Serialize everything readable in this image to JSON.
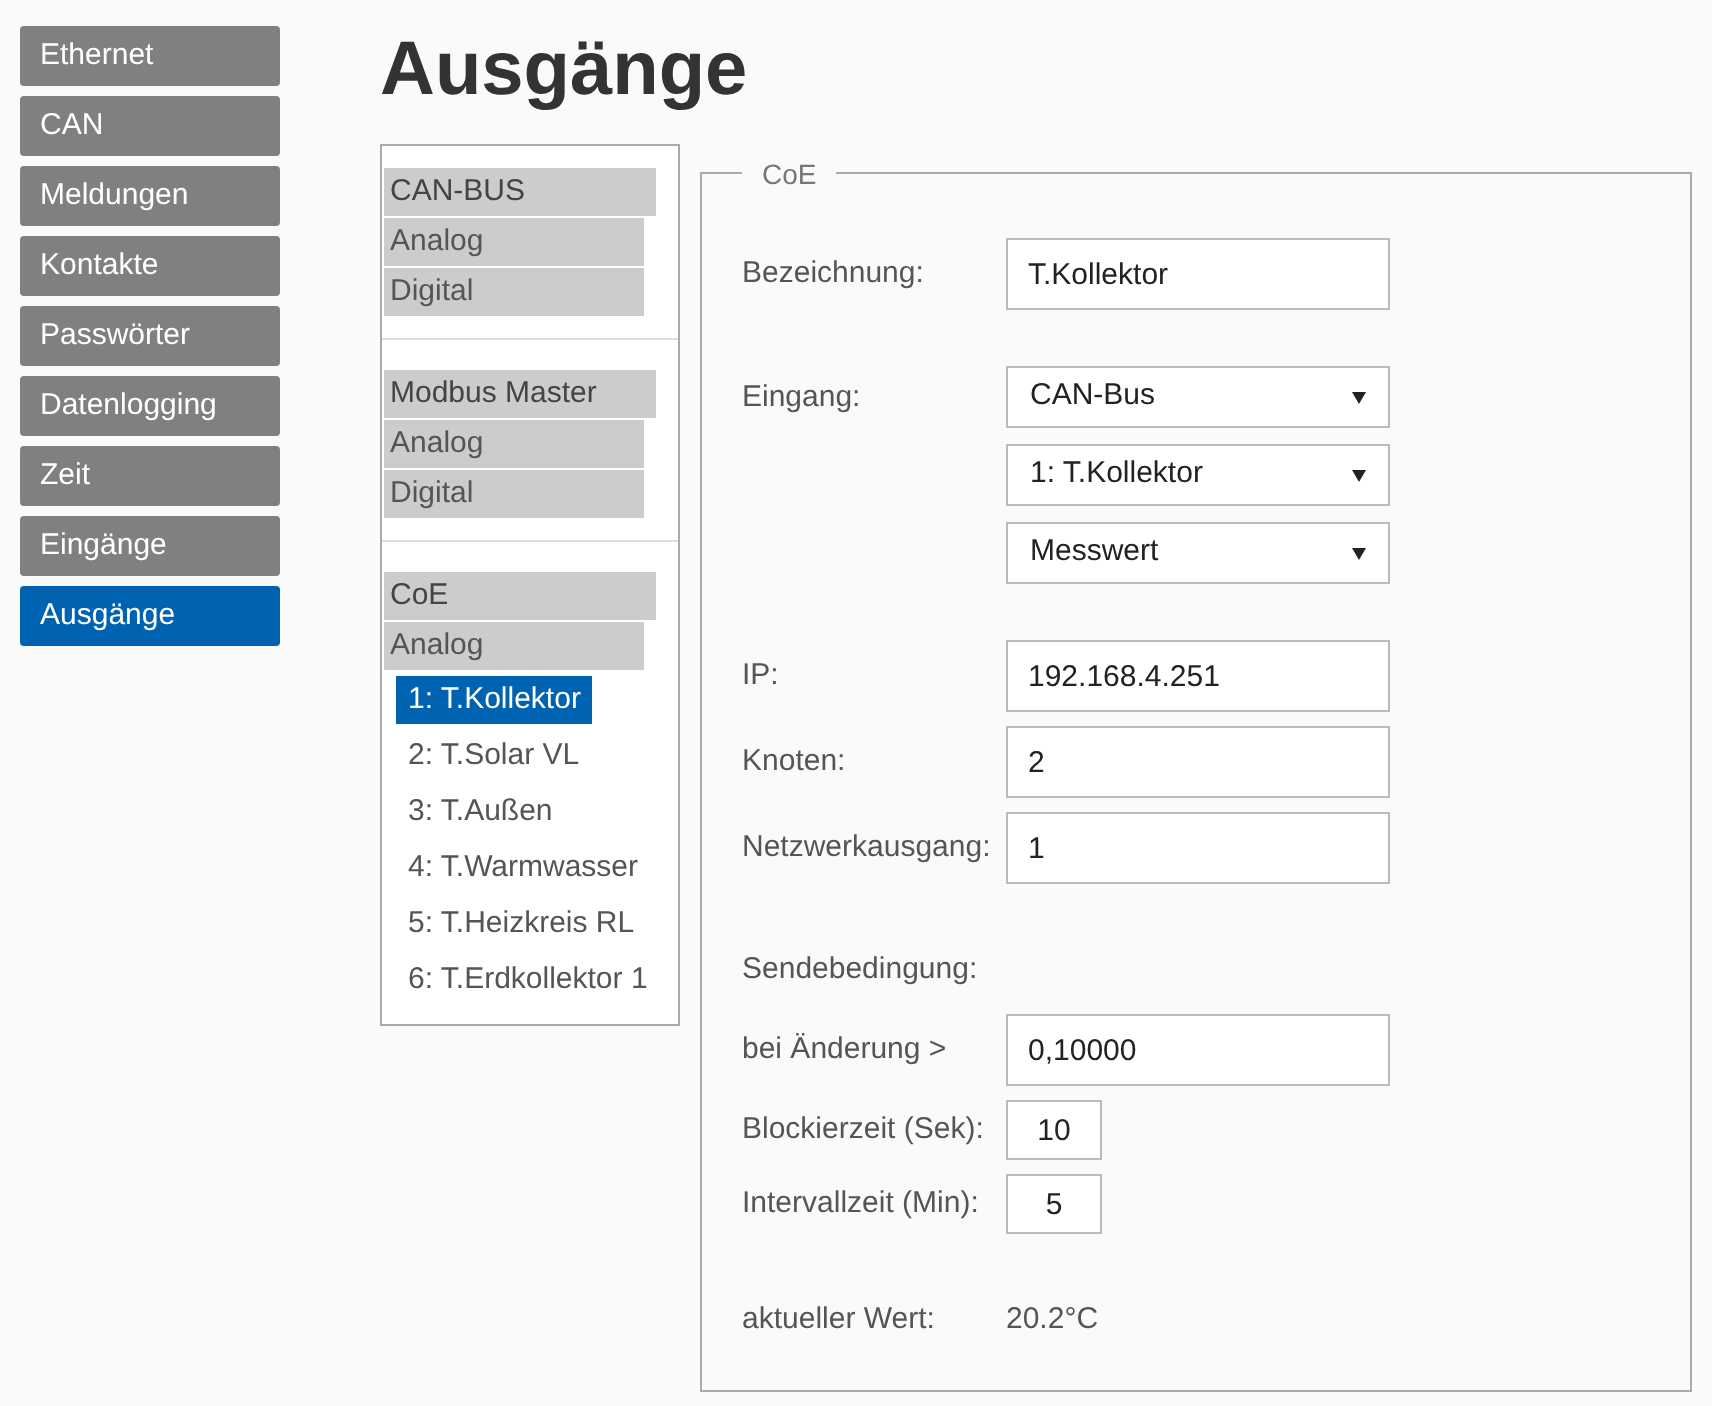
{
  "nav": [
    {
      "label": "Ethernet",
      "selected": false
    },
    {
      "label": "CAN",
      "selected": false
    },
    {
      "label": "Meldungen",
      "selected": false
    },
    {
      "label": "Kontakte",
      "selected": false
    },
    {
      "label": "Passwörter",
      "selected": false
    },
    {
      "label": "Datenlogging",
      "selected": false
    },
    {
      "label": "Zeit",
      "selected": false
    },
    {
      "label": "Eingänge",
      "selected": false
    },
    {
      "label": "Ausgänge",
      "selected": true
    }
  ],
  "title": "Ausgänge",
  "tree": [
    {
      "label": "CAN-BUS",
      "items": [
        {
          "label": "Analog"
        },
        {
          "label": "Digital"
        }
      ]
    },
    {
      "label": "Modbus Master",
      "items": [
        {
          "label": "Analog"
        },
        {
          "label": "Digital"
        }
      ]
    },
    {
      "label": "CoE",
      "items": [
        {
          "label": "Analog",
          "children": [
            {
              "label": "1: T.Kollektor",
              "selected": true
            },
            {
              "label": "2: T.Solar VL",
              "selected": false
            },
            {
              "label": "3: T.Außen",
              "selected": false
            },
            {
              "label": "4: T.Warmwasser",
              "selected": false
            },
            {
              "label": "5: T.Heizkreis RL",
              "selected": false
            },
            {
              "label": "6: T.Erdkollektor 1",
              "selected": false
            }
          ]
        }
      ]
    }
  ],
  "form": {
    "legend": "CoE",
    "groups": [
      [
        {
          "kind": "input",
          "label": "Bezeichnung:",
          "value": "T.Kollektor"
        }
      ],
      [
        {
          "kind": "select",
          "label": "Eingang:",
          "value": "CAN-Bus"
        },
        {
          "kind": "select",
          "value": "1: T.Kollektor"
        },
        {
          "kind": "select",
          "value": "Messwert"
        }
      ],
      [
        {
          "kind": "input",
          "label": "IP:",
          "value": "192.168.4.251"
        },
        {
          "kind": "input",
          "label": "Knoten:",
          "value": "2"
        },
        {
          "kind": "input",
          "label": "Netzwerkausgang:",
          "value": "1"
        }
      ],
      [
        {
          "kind": "heading",
          "label": "Sendebedingung:"
        },
        {
          "kind": "input",
          "label": "bei Änderung >",
          "value": "0,10000"
        },
        {
          "kind": "small",
          "label": "Blockierzeit (Sek):",
          "value": "10"
        },
        {
          "kind": "small",
          "label": "Intervallzeit (Min):",
          "value": "5"
        }
      ],
      [
        {
          "kind": "readout",
          "label": "aktueller Wert:",
          "value": "20.2°C"
        }
      ]
    ]
  }
}
